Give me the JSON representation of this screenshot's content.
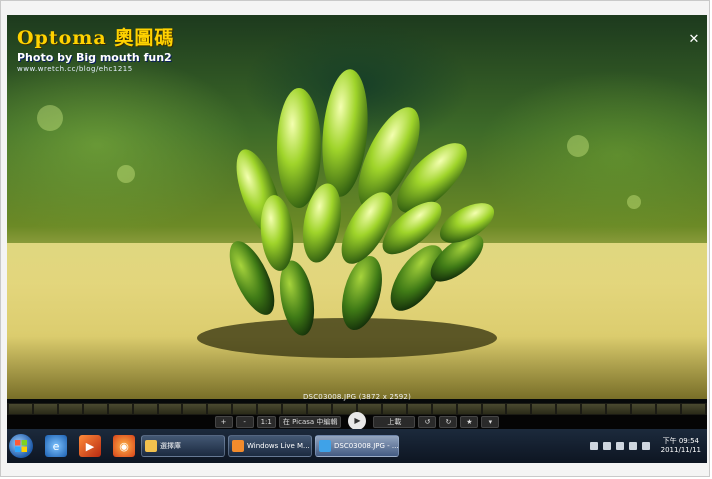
{
  "watermark": {
    "title": "Optoma 奧圖碼",
    "subtitle": "Photo by Big mouth fun2",
    "url": "www.wretch.cc/blog/ehc1215"
  },
  "viewer": {
    "caption": "DSC03008.JPG (3872 x 2592)",
    "close_icon": "close-icon",
    "toolbar": {
      "minus_label": "-",
      "plus_label": "+",
      "actual_size_label": "1:1",
      "picasa_label": "在 Picasa 中編輯",
      "upload_label": "上載",
      "rotate_left_icon": "rotate-left-icon",
      "rotate_right_icon": "rotate-right-icon",
      "star_icon": "star-icon",
      "more_icon": "chevron-down-icon"
    }
  },
  "taskbar": {
    "start_icon": "windows-start-icon",
    "pinned": [
      {
        "name": "internet-explorer-icon"
      },
      {
        "name": "media-player-icon"
      },
      {
        "name": "firefox-icon"
      }
    ],
    "tasks": [
      {
        "label": "選擇庫",
        "icon": "folder-icon",
        "active": false
      },
      {
        "label": "Windows Live M...",
        "icon": "windows-live-icon",
        "active": false
      },
      {
        "label": "DSC03008.JPG - ...",
        "icon": "photo-viewer-icon",
        "active": true
      }
    ],
    "clock": {
      "time": "下午 09:54",
      "date": "2011/11/11"
    }
  },
  "colors": {
    "watermark_yellow": "#ffd200",
    "taskbar_dark": "#0d1522"
  }
}
